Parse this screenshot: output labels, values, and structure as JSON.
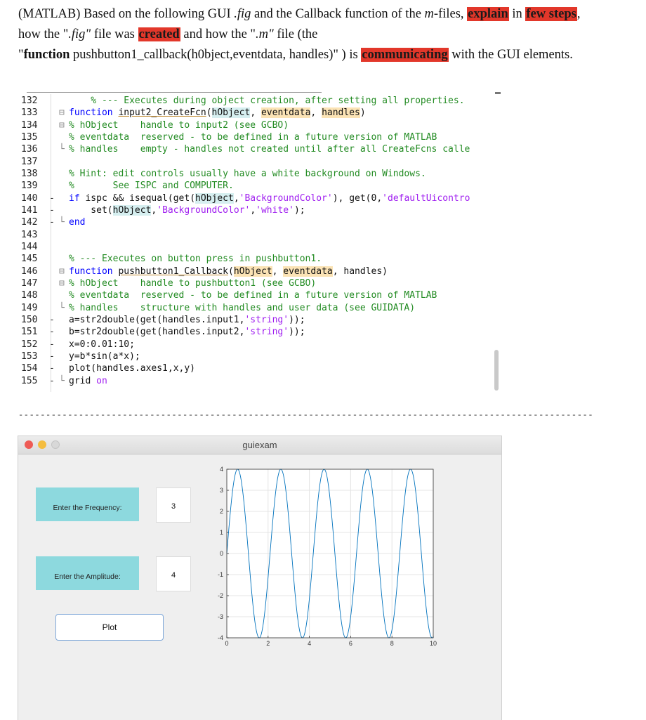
{
  "question": {
    "line1": {
      "p1": "(MATLAB) Based on the following GUI ",
      "p2": ".fig",
      "p3": " and the Callback function of the ",
      "p4": "m",
      "p5": "-files, ",
      "hl1": "explain",
      "p6": " in ",
      "hl2": "few steps",
      "p7": ","
    },
    "line2": {
      "p1": "how the \"",
      "p2": ".fig\"",
      "p3": " file was ",
      "hl": "created",
      "p4": " and how the \"",
      "p5": ".m\"",
      "p6": " file (the"
    },
    "line3": {
      "p1": "\"",
      "p2": "function",
      "p3": " pushbutton1_callback(h0bject,eventdata, handles)\" ) is ",
      "hl": "communicating",
      "p4": " with the GUI elements."
    }
  },
  "editor": {
    "lines": [
      {
        "num": "132",
        "dash": "",
        "fold": "",
        "segments": [
          {
            "t": "    % --- Executes during object creation, after setting all properties.",
            "c": "cm"
          }
        ]
      },
      {
        "num": "133",
        "dash": "",
        "fold": "⊟",
        "segments": [
          {
            "t": "function ",
            "c": "kw"
          },
          {
            "t": "input2_CreateFcn",
            "c": "ul"
          },
          {
            "t": "(",
            "c": ""
          },
          {
            "t": "hObject",
            "c": "hv1"
          },
          {
            "t": ", ",
            "c": ""
          },
          {
            "t": "eventdata",
            "c": "hv2"
          },
          {
            "t": ", ",
            "c": ""
          },
          {
            "t": "handles",
            "c": "hv2"
          },
          {
            "t": ")",
            "c": ""
          }
        ]
      },
      {
        "num": "134",
        "dash": "",
        "fold": "⊟",
        "segments": [
          {
            "t": "% hObject    handle to input2 (see GCBO)",
            "c": "cm"
          }
        ]
      },
      {
        "num": "135",
        "dash": "",
        "fold": "",
        "segments": [
          {
            "t": "% eventdata  reserved - to be defined in a future version of MATLAB",
            "c": "cm"
          }
        ]
      },
      {
        "num": "136",
        "dash": "",
        "fold": "└",
        "segments": [
          {
            "t": "% handles    empty - handles not created until after all CreateFcns calle",
            "c": "cm"
          }
        ]
      },
      {
        "num": "137",
        "dash": "",
        "fold": "",
        "segments": []
      },
      {
        "num": "138",
        "dash": "",
        "fold": "",
        "segments": [
          {
            "t": "% Hint: edit controls usually have a white background on Windows.",
            "c": "cm"
          }
        ]
      },
      {
        "num": "139",
        "dash": "",
        "fold": "",
        "segments": [
          {
            "t": "%       See ISPC and COMPUTER.",
            "c": "cm"
          }
        ]
      },
      {
        "num": "140",
        "dash": "-",
        "fold": "",
        "segments": [
          {
            "t": "if ",
            "c": "kw"
          },
          {
            "t": "ispc && isequal(get(",
            "c": ""
          },
          {
            "t": "hObject",
            "c": "hv1"
          },
          {
            "t": ",",
            "c": ""
          },
          {
            "t": "'BackgroundColor'",
            "c": "st"
          },
          {
            "t": "), get(0,",
            "c": ""
          },
          {
            "t": "'defaultUicontro",
            "c": "st"
          }
        ]
      },
      {
        "num": "141",
        "dash": "-",
        "fold": "",
        "segments": [
          {
            "t": "    set(",
            "c": ""
          },
          {
            "t": "hObject",
            "c": "hv1"
          },
          {
            "t": ",",
            "c": ""
          },
          {
            "t": "'BackgroundColor'",
            "c": "st"
          },
          {
            "t": ",",
            "c": ""
          },
          {
            "t": "'white'",
            "c": "st"
          },
          {
            "t": ");",
            "c": ""
          }
        ]
      },
      {
        "num": "142",
        "dash": "-",
        "fold": "└",
        "segments": [
          {
            "t": "end",
            "c": "kw"
          }
        ]
      },
      {
        "num": "143",
        "dash": "",
        "fold": "",
        "segments": []
      },
      {
        "num": "144",
        "dash": "",
        "fold": "",
        "segments": []
      },
      {
        "num": "145",
        "dash": "",
        "fold": "",
        "segments": [
          {
            "t": "% --- Executes on button press in pushbutton1.",
            "c": "cm"
          }
        ]
      },
      {
        "num": "146",
        "dash": "",
        "fold": "⊟",
        "segments": [
          {
            "t": "function ",
            "c": "kw"
          },
          {
            "t": "pushbutton1_Callback",
            "c": "ul"
          },
          {
            "t": "(",
            "c": ""
          },
          {
            "t": "hObject",
            "c": "hv2"
          },
          {
            "t": ", ",
            "c": ""
          },
          {
            "t": "eventdata",
            "c": "hv2"
          },
          {
            "t": ", handles)",
            "c": ""
          }
        ]
      },
      {
        "num": "147",
        "dash": "",
        "fold": "⊟",
        "segments": [
          {
            "t": "% hObject    handle to pushbutton1 (see GCBO)",
            "c": "cm"
          }
        ]
      },
      {
        "num": "148",
        "dash": "",
        "fold": "",
        "segments": [
          {
            "t": "% eventdata  reserved - to be defined in a future version of MATLAB",
            "c": "cm"
          }
        ]
      },
      {
        "num": "149",
        "dash": "",
        "fold": "└",
        "segments": [
          {
            "t": "% handles    structure with handles and user data (see GUIDATA)",
            "c": "cm"
          }
        ]
      },
      {
        "num": "150",
        "dash": "-",
        "fold": "",
        "segments": [
          {
            "t": "a=str2double(get(handles.input1,",
            "c": ""
          },
          {
            "t": "'string'",
            "c": "st"
          },
          {
            "t": "));",
            "c": ""
          }
        ]
      },
      {
        "num": "151",
        "dash": "-",
        "fold": "",
        "segments": [
          {
            "t": "b=str2double(get(handles.input2,",
            "c": ""
          },
          {
            "t": "'string'",
            "c": "st"
          },
          {
            "t": "));",
            "c": ""
          }
        ]
      },
      {
        "num": "152",
        "dash": "-",
        "fold": "",
        "segments": [
          {
            "t": "x=0:0.01:10;",
            "c": ""
          }
        ]
      },
      {
        "num": "153",
        "dash": "-",
        "fold": "",
        "segments": [
          {
            "t": "y=b*sin(a*x);",
            "c": ""
          }
        ]
      },
      {
        "num": "154",
        "dash": "-",
        "fold": "",
        "segments": [
          {
            "t": "plot(handles.axes1,x,y)",
            "c": ""
          }
        ]
      },
      {
        "num": "155",
        "dash": "-",
        "fold": "└",
        "segments": [
          {
            "t": "grid ",
            "c": ""
          },
          {
            "t": "on",
            "c": "st"
          }
        ]
      }
    ]
  },
  "separator": "------------------------------------------------------------------------------------------------------------------------------",
  "gui": {
    "title": "guiexam",
    "freq_label": "Enter the Frequency:",
    "freq_value": "3",
    "amp_label": "Enter the Amplitude:",
    "amp_value": "4",
    "plot_button": "Plot"
  },
  "chart_data": {
    "type": "line",
    "function": "y = 4*sin(3*x)",
    "frequency": 3,
    "amplitude": 4,
    "x_range": [
      0,
      10
    ],
    "x_step": 0.01,
    "xlim": [
      0,
      10
    ],
    "ylim": [
      -4,
      4
    ],
    "xticks": [
      "0",
      "2",
      "4",
      "6",
      "8",
      "10"
    ],
    "yticks": [
      "4",
      "3",
      "2",
      "1",
      "0",
      "-1",
      "-2",
      "-3",
      "-4"
    ],
    "grid": true,
    "line_color": "#0072bd"
  }
}
